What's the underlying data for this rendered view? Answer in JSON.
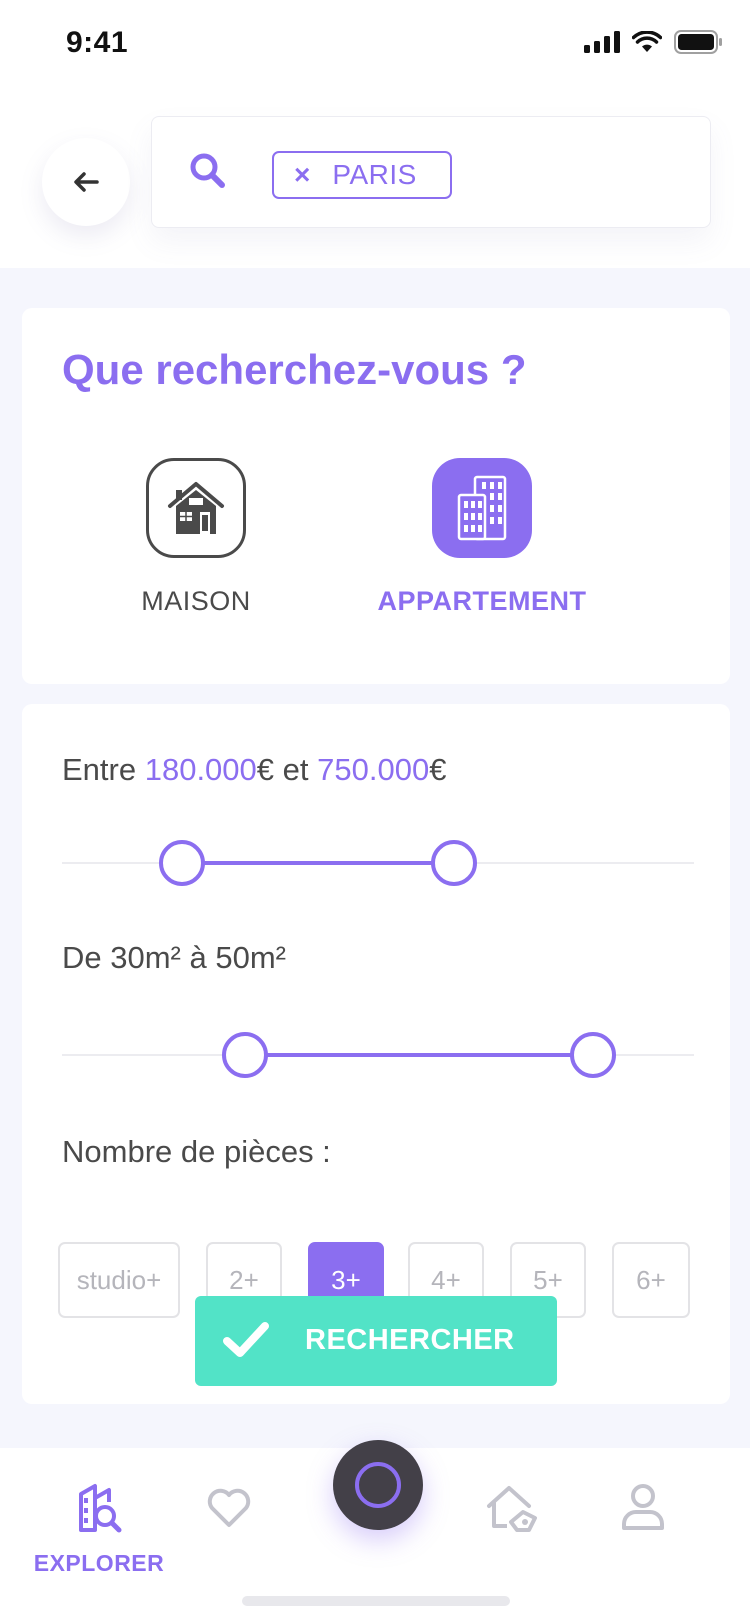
{
  "status_bar": {
    "time": "9:41"
  },
  "search": {
    "chip_label": "PARIS",
    "chip_remove": "×"
  },
  "property_type": {
    "title": "Que recherchez-vous ?",
    "options": [
      {
        "label": "MAISON",
        "icon": "house-icon",
        "selected": false
      },
      {
        "label": "APPARTEMENT",
        "icon": "building-icon",
        "selected": true
      }
    ]
  },
  "price_filter": {
    "prefix": "Entre ",
    "min_value": "180.000",
    "currency1": "€",
    "conjunction": " et ",
    "max_value": "750.000",
    "currency2": "€",
    "range_min_fraction": 0.19,
    "range_max_fraction": 0.62
  },
  "area_filter": {
    "label": "De 30m² à 50m²",
    "range_min_fraction": 0.29,
    "range_max_fraction": 0.84
  },
  "rooms_filter": {
    "label": "Nombre de pièces :",
    "options": [
      "studio+",
      "2+",
      "3+",
      "4+",
      "5+",
      "6+"
    ],
    "selected": "3+"
  },
  "search_button": {
    "label": "RECHERCHER"
  },
  "tabbar": {
    "explore_label": "EXPLORER",
    "tabs": [
      "explore-icon",
      "heart-icon",
      "center-action",
      "sell-house-icon",
      "profile-icon"
    ]
  },
  "colors": {
    "accent": "#8b6ef0",
    "cta": "#52e3c7",
    "text": "#4a4a4a",
    "background": "#f5f6fd"
  }
}
